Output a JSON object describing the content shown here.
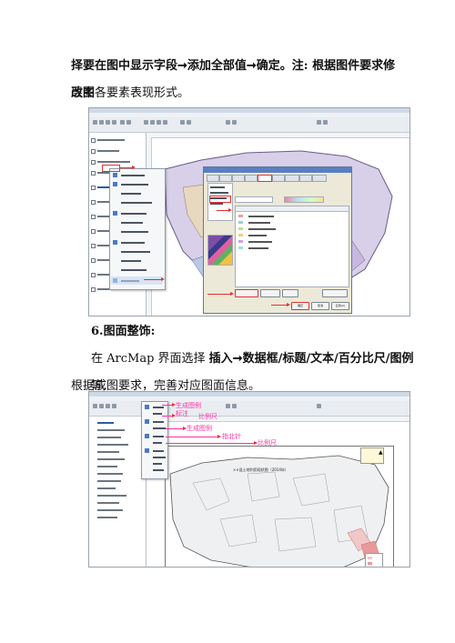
{
  "paragraph1": {
    "line1": "择要在图中显示字段➞添加全部值➞确定。注: 根据图件要求修改图",
    "line2": "层中各要素表现形式。"
  },
  "section6": {
    "heading": "6.图面整饰:",
    "line1_plain": "在 ArcMap 界面选择 ",
    "line1_bold": "插入➞数据框/标题/文本/百分比尺/图例",
    "line1_tail": "等,",
    "line2": "根据成图要求，完善对应图面信息。"
  },
  "screenshot1": {
    "dialog_ok": "确定",
    "dialog_cancel": "取消",
    "dialog_apply": "应用(A)"
  },
  "screenshot2": {
    "annotations": [
      "生成图例",
      "标注",
      "比例尺",
      "生成图例",
      "指北针",
      "比例尺"
    ],
    "map_title": "××县土地利用现状图（2014年）"
  },
  "colors": {
    "annotation": "#ff2fa6",
    "highlight": "#e53030",
    "map_fill_a": "#7b4fa8",
    "map_fill_b": "#d8cfe8",
    "map_fill_c": "#f0c8c8",
    "map_fill_d": "#d8dce0"
  }
}
